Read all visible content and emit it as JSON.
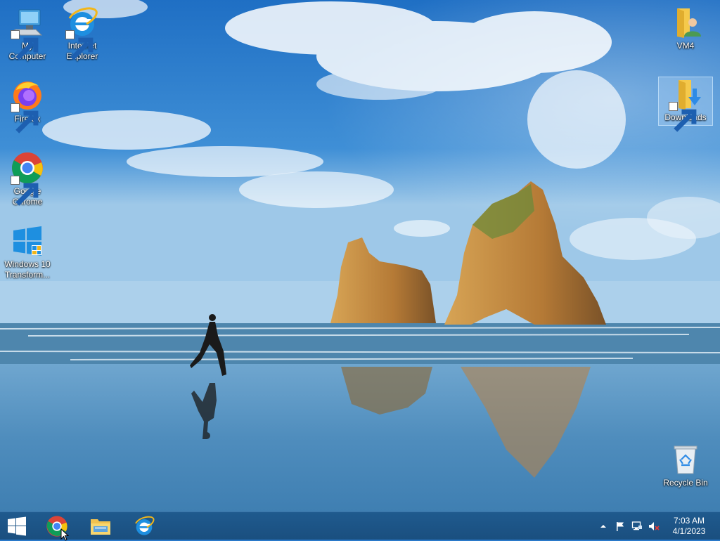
{
  "desktop": {
    "icons": [
      {
        "label": "My Computer"
      },
      {
        "label": "Internet Explorer"
      },
      {
        "label": "Firefox"
      },
      {
        "label": "Google Chrome"
      },
      {
        "label": "Windows 10 Transform..."
      },
      {
        "label": "VM4"
      },
      {
        "label": "Downloads"
      },
      {
        "label": "Recycle Bin"
      }
    ]
  },
  "taskbar": {
    "pinned": [
      {
        "icon": "chrome-icon"
      },
      {
        "icon": "file-explorer-icon"
      },
      {
        "icon": "internet-explorer-icon"
      }
    ],
    "tray": {
      "clock_time": "7:03 AM",
      "clock_date": "4/1/2023"
    }
  },
  "colors": {
    "taskbar": "#1a4f7f",
    "sky": "#2a79c9",
    "sea": "#4a8cb8",
    "rock": "#c98a3c"
  }
}
